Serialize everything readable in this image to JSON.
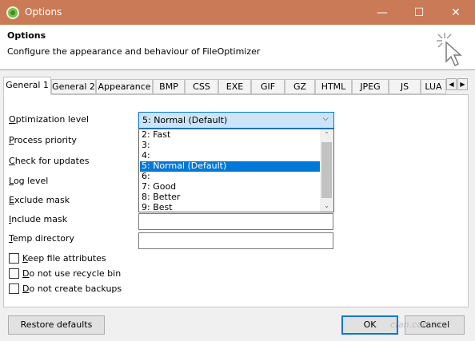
{
  "window": {
    "title": "Options",
    "min_glyph": "—",
    "max_glyph": "☐",
    "close_glyph": "✕"
  },
  "header": {
    "title": "Options",
    "subtitle": "Configure the appearance and behaviour of FileOptimizer"
  },
  "tabs": [
    "General 1",
    "General 2",
    "Appearance",
    "BMP",
    "CSS",
    "EXE",
    "GIF",
    "GZ",
    "HTML",
    "JPEG",
    "JS",
    "LUA"
  ],
  "tab_scroll": {
    "left": "◀",
    "right": "▶"
  },
  "fields": {
    "optimization_level": {
      "label": "Optimization level",
      "value": "5: Normal (Default)",
      "arrow": "⌵"
    },
    "process_priority": {
      "label": "Process priority"
    },
    "check_updates": {
      "label": "Check for updates"
    },
    "log_level": {
      "label": "Log level"
    },
    "exclude_mask": {
      "label": "Exclude mask",
      "value": ""
    },
    "include_mask": {
      "label": "Include mask",
      "value": ""
    },
    "temp_directory": {
      "label": "Temp directory",
      "value": ""
    }
  },
  "dropdown": {
    "options": [
      "2: Fast",
      "3:",
      "4:",
      "5: Normal (Default)",
      "6:",
      "7: Good",
      "8: Better",
      "9: Best"
    ],
    "selected_index": 3,
    "scroll_up": "⌃",
    "scroll_down": "⌄"
  },
  "checkboxes": [
    {
      "label": "Keep file attributes",
      "checked": false
    },
    {
      "label": "Do not use recycle bin",
      "checked": false
    },
    {
      "label": "Do not create backups",
      "checked": false
    }
  ],
  "buttons": {
    "restore": "Restore defaults",
    "ok": "OK",
    "cancel": "Cancel"
  },
  "watermark": "cfan.com.cn",
  "colors": {
    "titlebar": "#ca7a56",
    "selection": "#0078d7",
    "combo_focus": "#cce4f7"
  }
}
